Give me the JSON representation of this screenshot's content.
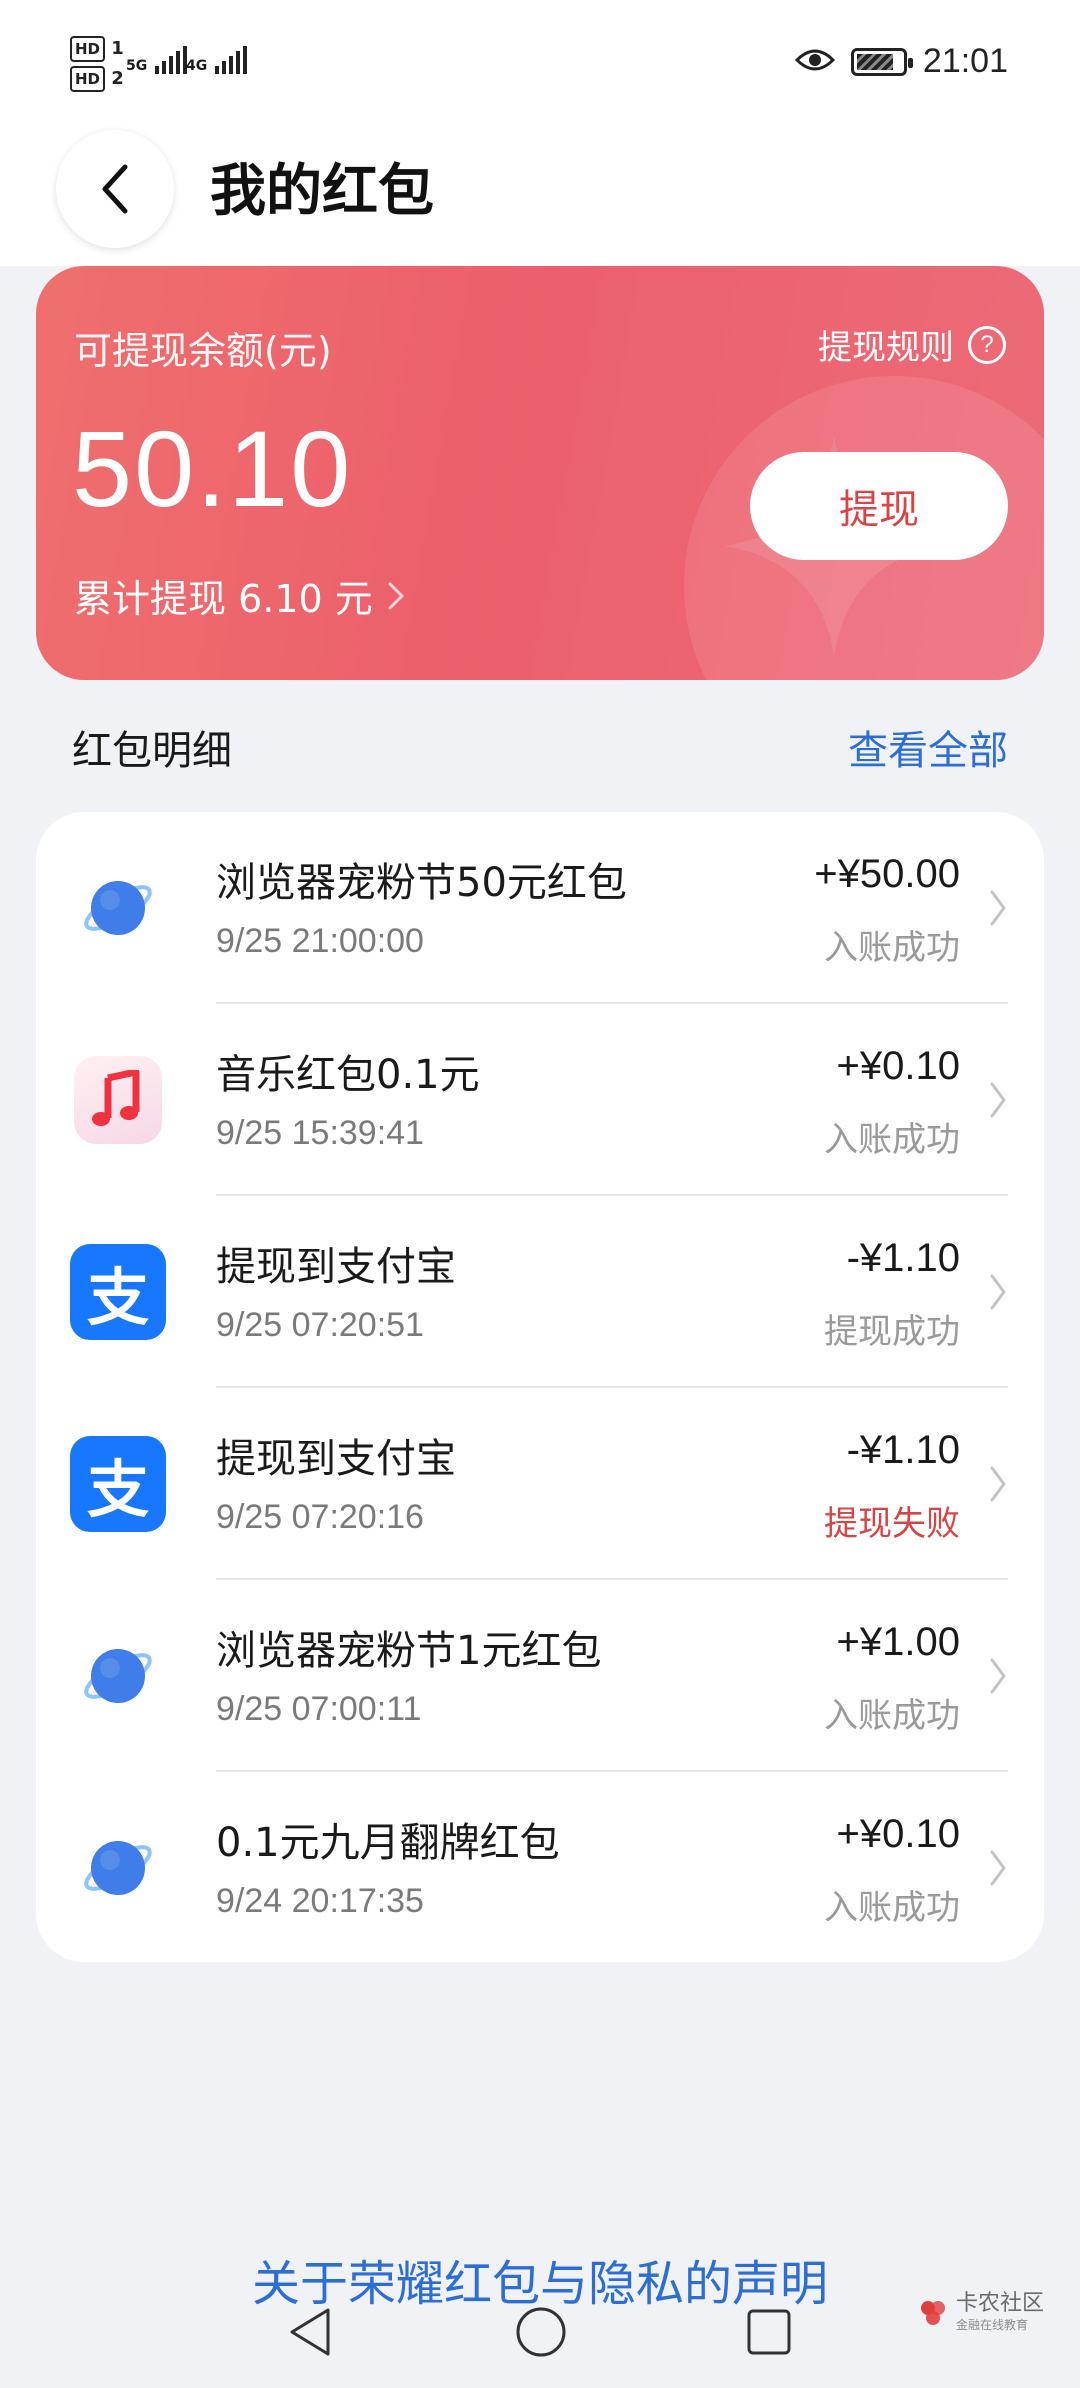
{
  "status_bar": {
    "sim1": "HD",
    "sim1_index": "1",
    "sim2": "HD",
    "sim2_index": "2",
    "network1": "5G",
    "network2": "4G",
    "time": "21:01"
  },
  "header": {
    "title": "我的红包"
  },
  "balance": {
    "label": "可提现余额(元)",
    "rules_label": "提现规则",
    "amount": "50.10",
    "withdraw_label": "提现",
    "total_withdrawn_label": "累计提现 6.10 元",
    "card_color": "#ec6370"
  },
  "records_section": {
    "title": "红包明细",
    "view_all_label": "查看全部"
  },
  "records": [
    {
      "icon": "browser-planet-icon",
      "title": "浏览器宠粉节50元红包",
      "time": "9/25 21:00:00",
      "amount": "+¥50.00",
      "status": "入账成功",
      "status_type": "success"
    },
    {
      "icon": "music-note-icon",
      "title": "音乐红包0.1元",
      "time": "9/25 15:39:41",
      "amount": "+¥0.10",
      "status": "入账成功",
      "status_type": "success"
    },
    {
      "icon": "alipay-icon",
      "title": "提现到支付宝",
      "time": "9/25 07:20:51",
      "amount": "-¥1.10",
      "status": "提现成功",
      "status_type": "success"
    },
    {
      "icon": "alipay-icon",
      "title": "提现到支付宝",
      "time": "9/25 07:20:16",
      "amount": "-¥1.10",
      "status": "提现失败",
      "status_type": "fail"
    },
    {
      "icon": "browser-planet-icon",
      "title": "浏览器宠粉节1元红包",
      "time": "9/25 07:00:11",
      "amount": "+¥1.00",
      "status": "入账成功",
      "status_type": "success"
    },
    {
      "icon": "browser-planet-icon",
      "title": "0.1元九月翻牌红包",
      "time": "9/24 20:17:35",
      "amount": "+¥0.10",
      "status": "入账成功",
      "status_type": "success"
    }
  ],
  "alipay_glyph": "支",
  "footer": {
    "privacy_link": "关于荣耀红包与隐私的声明"
  },
  "watermark": {
    "name": "卡农社区",
    "subtitle": "金融在线教育"
  },
  "colors": {
    "accent_blue": "#2c6ed6",
    "fail_red": "#d64545",
    "alipay_blue": "#1777ff"
  }
}
